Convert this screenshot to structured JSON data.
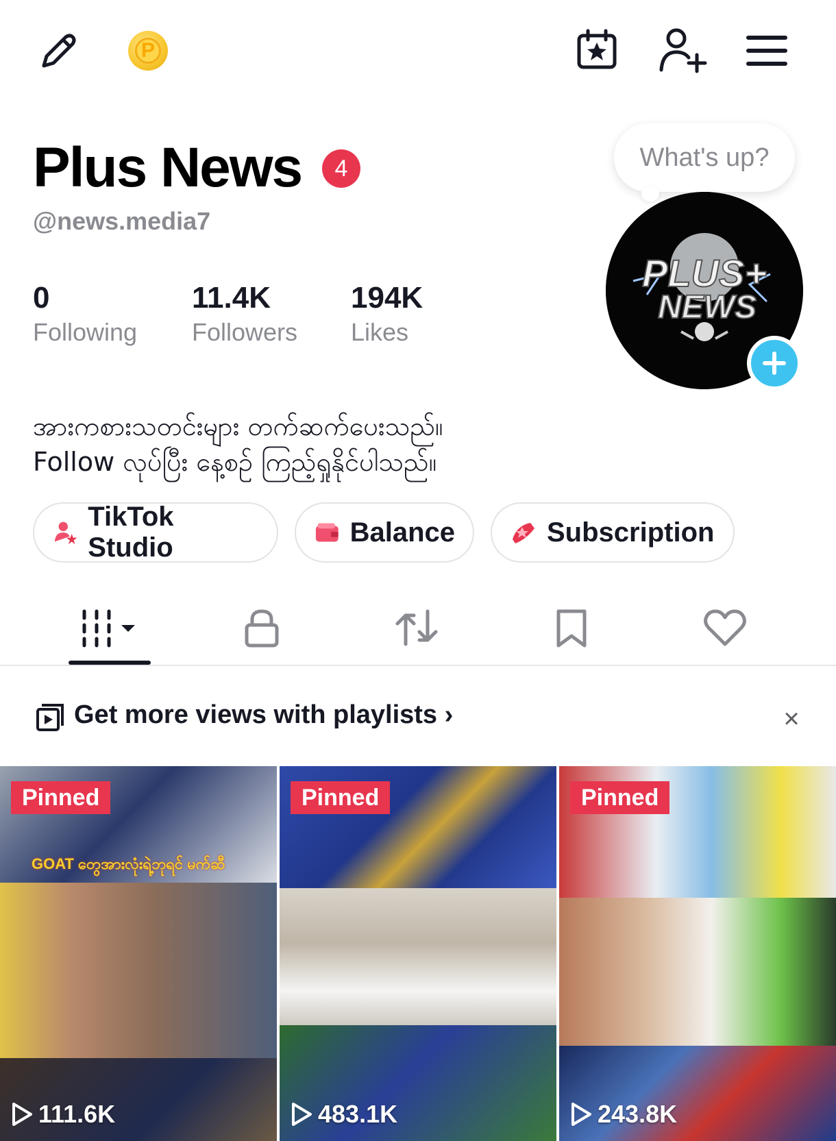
{
  "header": {
    "edit_icon": "pencil-icon",
    "coin_icon": "coin-icon",
    "coin_letter": "P",
    "calendar_icon": "calendar-star-icon",
    "add_friend_icon": "add-user-icon",
    "menu_icon": "hamburger-menu-icon"
  },
  "profile": {
    "name": "Plus News",
    "badge_count": "4",
    "username": "@news.media7",
    "bubble_text": "What's up?",
    "stats": [
      {
        "value": "0",
        "label": "Following"
      },
      {
        "value": "11.4K",
        "label": "Followers"
      },
      {
        "value": "194K",
        "label": "Likes"
      }
    ],
    "bio_line1": "အားကစားသတင်းများ တက်ဆက်ပေးသည်။",
    "bio_line2": "Follow လုပ်ပြီး နေ့စဉ် ကြည့်ရှုနိုင်ပါသည်။",
    "avatar_text_line1": "PLUS+",
    "avatar_text_line2": "NEWS"
  },
  "chips": [
    {
      "label": "TikTok Studio",
      "icon": "studio-icon"
    },
    {
      "label": "Balance",
      "icon": "wallet-icon"
    },
    {
      "label": "Subscription",
      "icon": "subscription-icon"
    }
  ],
  "tabs": [
    {
      "name": "videos",
      "icon": "grid-icon",
      "active": true
    },
    {
      "name": "private",
      "icon": "lock-icon"
    },
    {
      "name": "reposts",
      "icon": "repost-icon"
    },
    {
      "name": "favorites",
      "icon": "bookmark-icon"
    },
    {
      "name": "liked",
      "icon": "heart-icon"
    }
  ],
  "playlist_banner": {
    "text": "Get more views with playlists",
    "chevron": "›",
    "close": "×"
  },
  "videos": [
    {
      "badge": "Pinned",
      "views": "111.6K",
      "caption": "GOAT တွေအားလုံးရဲ့ဘုရင် မက်ဆီ"
    },
    {
      "badge": "Pinned",
      "views": "483.1K"
    },
    {
      "badge": "Pinned",
      "views": "243.8K"
    }
  ],
  "colors": {
    "accent_red": "#e8364f",
    "accent_blue": "#3ec3f0",
    "text_primary": "#161823",
    "text_secondary": "#8a8b91"
  }
}
